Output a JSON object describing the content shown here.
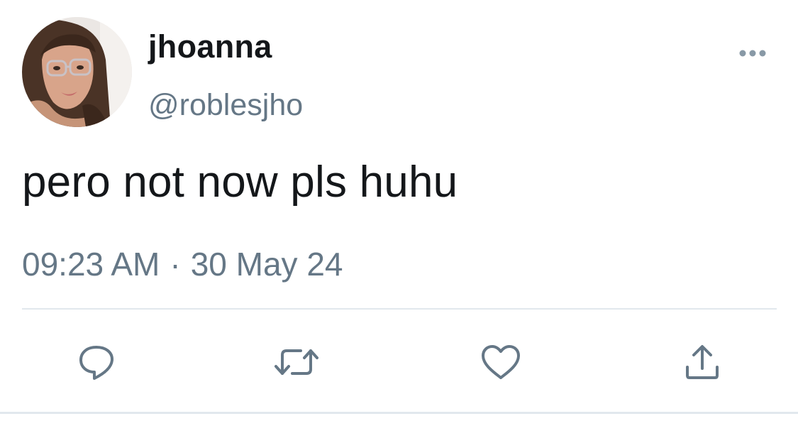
{
  "tweet": {
    "display_name": "jhoanna",
    "handle": "@roblesjho",
    "text": "pero not now pls huhu",
    "time": "09:23 AM",
    "separator": "·",
    "date": "30 May 24"
  },
  "icons": {
    "more": "more-options-icon",
    "reply": "reply-icon",
    "retweet": "retweet-icon",
    "like": "heart-icon",
    "share": "share-icon"
  },
  "colors": {
    "text": "#14171a",
    "secondary": "#657786",
    "divider": "#e1e8ed"
  }
}
